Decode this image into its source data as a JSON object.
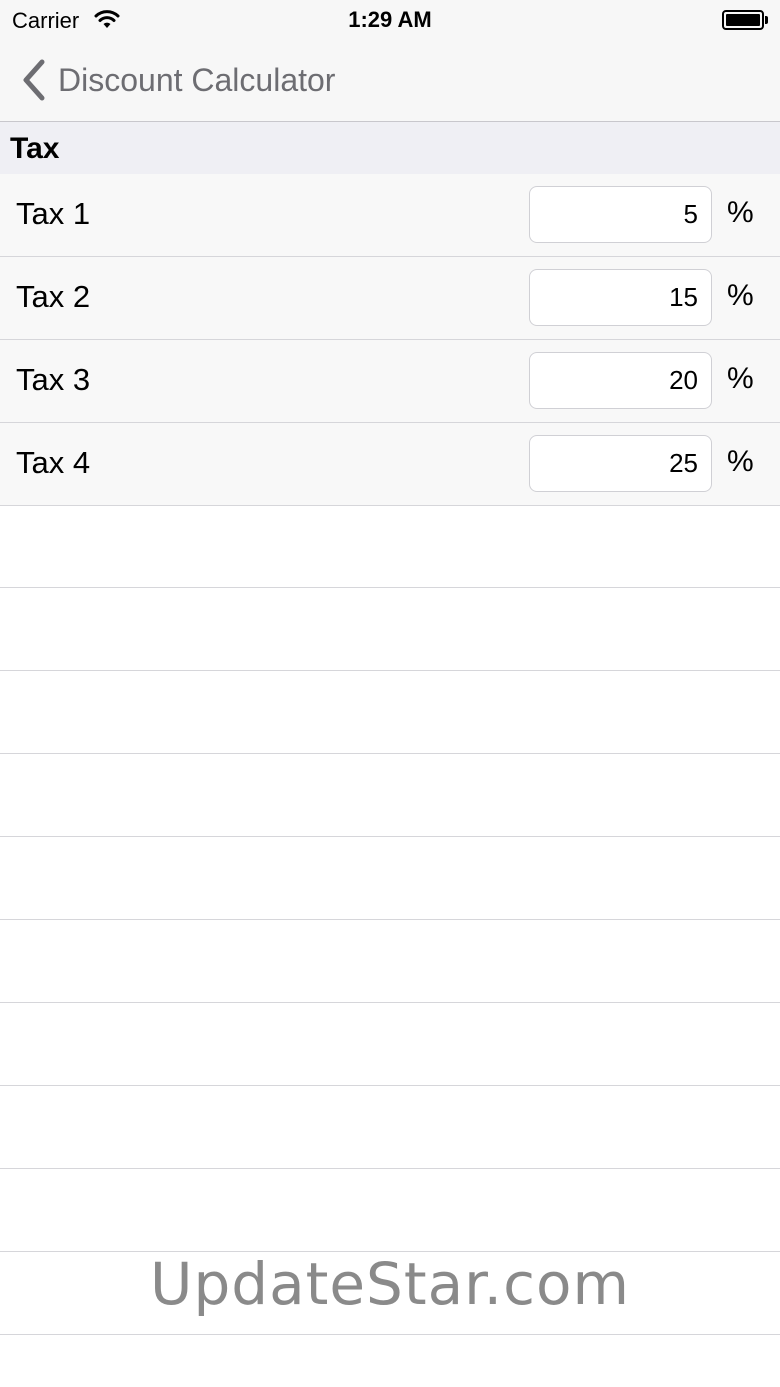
{
  "status_bar": {
    "carrier": "Carrier",
    "time": "1:29 AM"
  },
  "nav": {
    "back_label": "Discount Calculator"
  },
  "section": {
    "title": "Tax"
  },
  "taxes": [
    {
      "label": "Tax 1",
      "value": "5",
      "unit": "%"
    },
    {
      "label": "Tax 2",
      "value": "15",
      "unit": "%"
    },
    {
      "label": "Tax 3",
      "value": "20",
      "unit": "%"
    },
    {
      "label": "Tax 4",
      "value": "25",
      "unit": "%"
    }
  ],
  "watermark": "UpdateStar.com"
}
